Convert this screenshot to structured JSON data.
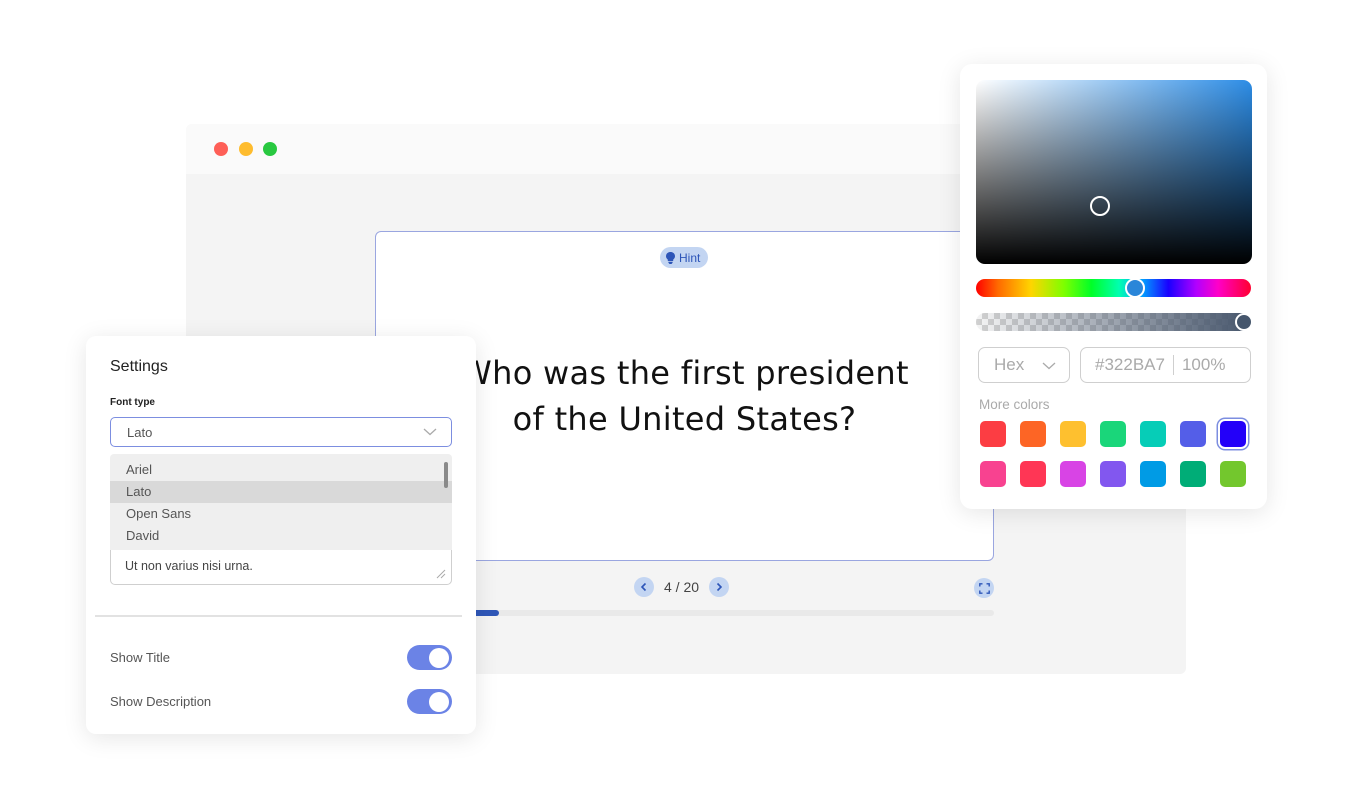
{
  "browser": {
    "window_controls": [
      "close",
      "minimize",
      "maximize"
    ]
  },
  "flashcard": {
    "hint_label": "Hint",
    "question_line1": "Who was the first president",
    "question_line2": "of the United States?",
    "current_page": 4,
    "total_pages": 20,
    "page_label": "4 / 20",
    "progress_fraction": 0.2
  },
  "settings": {
    "title": "Settings",
    "font_type_label": "Font type",
    "font_selected": "Lato",
    "font_options": [
      "Ariel",
      "Lato",
      "Open Sans",
      "David"
    ],
    "description_value": "Ut non varius nisi urna.",
    "toggles": [
      {
        "label": "Show Title",
        "on": true
      },
      {
        "label": "Show Description",
        "on": true
      }
    ]
  },
  "color_picker": {
    "format": "Hex",
    "hex_value": "#322BA7",
    "alpha_value": "100%",
    "more_colors_label": "More colors",
    "swatches": [
      "#fc3d43",
      "#fd6525",
      "#fec02f",
      "#1ad67a",
      "#06cdb7",
      "#545ee8",
      "#2300f9",
      "#f84290",
      "#ff3655",
      "#d844e5",
      "#8257ef",
      "#009be5",
      "#00ad77",
      "#73c72d"
    ],
    "selected_swatch_index": 6
  },
  "colors": {
    "accent": "#6b83e6",
    "hint_bg": "#c3d5f2",
    "progress": "#2f57b8"
  }
}
